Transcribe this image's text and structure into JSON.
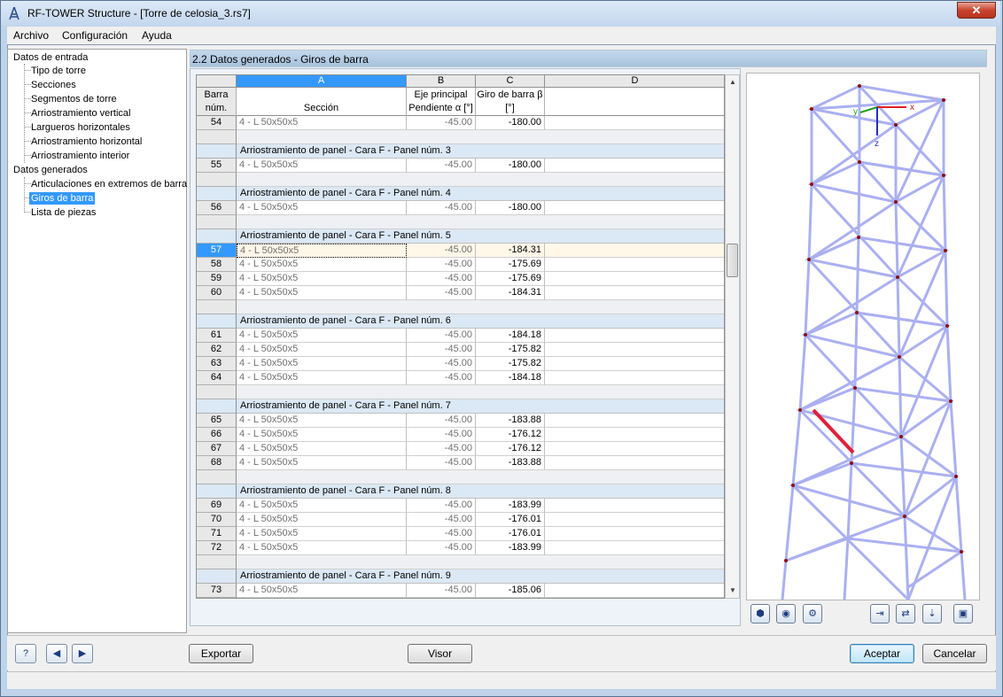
{
  "window": {
    "title": "RF-TOWER Structure - [Torre de celosia_3.rs7]",
    "close_label": "✕"
  },
  "menu": [
    "Archivo",
    "Configuración",
    "Ayuda"
  ],
  "tree": {
    "group1": "Datos de entrada",
    "group1_items": [
      "Tipo de torre",
      "Secciones",
      "Segmentos de torre",
      "Arriostramiento vertical",
      "Largueros horizontales",
      "Arriostramiento horizontal",
      "Arriostramiento interior"
    ],
    "group2": "Datos generados",
    "group2_items": [
      "Articulaciones en extremos de barra",
      "Giros de barra",
      "Lista de piezas"
    ],
    "selected": "Giros de barra"
  },
  "panel_title": "2.2 Datos generados - Giros de barra",
  "grid": {
    "columns": [
      "A",
      "B",
      "C",
      "D"
    ],
    "rowhdr_label": "Barra núm.",
    "headers": {
      "A": "Sección",
      "B": "Eje principal Pendiente α [°]",
      "C": "Giro de barra β [°]",
      "D": ""
    },
    "rows": [
      {
        "kind": "data",
        "num": "54",
        "section": "4 - L 50x50x5",
        "alpha": "-45.00",
        "beta": "-180.00"
      },
      {
        "kind": "blank"
      },
      {
        "kind": "group",
        "label": "Arriostramiento de panel  - Cara F  - Panel núm. 3"
      },
      {
        "kind": "data",
        "num": "55",
        "section": "4 - L 50x50x5",
        "alpha": "-45.00",
        "beta": "-180.00"
      },
      {
        "kind": "blank"
      },
      {
        "kind": "group",
        "label": "Arriostramiento de panel  - Cara F  - Panel núm. 4"
      },
      {
        "kind": "data",
        "num": "56",
        "section": "4 - L 50x50x5",
        "alpha": "-45.00",
        "beta": "-180.00"
      },
      {
        "kind": "blank"
      },
      {
        "kind": "group",
        "label": "Arriostramiento de panel  - Cara F  - Panel núm. 5"
      },
      {
        "kind": "data",
        "num": "57",
        "section": "4 - L 50x50x5",
        "alpha": "-45.00",
        "beta": "-184.31",
        "selected": true
      },
      {
        "kind": "data",
        "num": "58",
        "section": "4 - L 50x50x5",
        "alpha": "-45.00",
        "beta": "-175.69"
      },
      {
        "kind": "data",
        "num": "59",
        "section": "4 - L 50x50x5",
        "alpha": "-45.00",
        "beta": "-175.69"
      },
      {
        "kind": "data",
        "num": "60",
        "section": "4 - L 50x50x5",
        "alpha": "-45.00",
        "beta": "-184.31"
      },
      {
        "kind": "blank"
      },
      {
        "kind": "group",
        "label": "Arriostramiento de panel  - Cara F  - Panel núm. 6"
      },
      {
        "kind": "data",
        "num": "61",
        "section": "4 - L 50x50x5",
        "alpha": "-45.00",
        "beta": "-184.18"
      },
      {
        "kind": "data",
        "num": "62",
        "section": "4 - L 50x50x5",
        "alpha": "-45.00",
        "beta": "-175.82"
      },
      {
        "kind": "data",
        "num": "63",
        "section": "4 - L 50x50x5",
        "alpha": "-45.00",
        "beta": "-175.82"
      },
      {
        "kind": "data",
        "num": "64",
        "section": "4 - L 50x50x5",
        "alpha": "-45.00",
        "beta": "-184.18"
      },
      {
        "kind": "blank"
      },
      {
        "kind": "group",
        "label": "Arriostramiento de panel  - Cara F  - Panel núm. 7"
      },
      {
        "kind": "data",
        "num": "65",
        "section": "4 - L 50x50x5",
        "alpha": "-45.00",
        "beta": "-183.88"
      },
      {
        "kind": "data",
        "num": "66",
        "section": "4 - L 50x50x5",
        "alpha": "-45.00",
        "beta": "-176.12"
      },
      {
        "kind": "data",
        "num": "67",
        "section": "4 - L 50x50x5",
        "alpha": "-45.00",
        "beta": "-176.12"
      },
      {
        "kind": "data",
        "num": "68",
        "section": "4 - L 50x50x5",
        "alpha": "-45.00",
        "beta": "-183.88"
      },
      {
        "kind": "blank"
      },
      {
        "kind": "group",
        "label": "Arriostramiento de panel  - Cara F  - Panel núm. 8"
      },
      {
        "kind": "data",
        "num": "69",
        "section": "4 - L 50x50x5",
        "alpha": "-45.00",
        "beta": "-183.99"
      },
      {
        "kind": "data",
        "num": "70",
        "section": "4 - L 50x50x5",
        "alpha": "-45.00",
        "beta": "-176.01"
      },
      {
        "kind": "data",
        "num": "71",
        "section": "4 - L 50x50x5",
        "alpha": "-45.00",
        "beta": "-176.01"
      },
      {
        "kind": "data",
        "num": "72",
        "section": "4 - L 50x50x5",
        "alpha": "-45.00",
        "beta": "-183.99"
      },
      {
        "kind": "blank"
      },
      {
        "kind": "group",
        "label": "Arriostramiento de panel  - Cara F  - Panel núm. 9"
      },
      {
        "kind": "data",
        "num": "73",
        "section": "4 - L 50x50x5",
        "alpha": "-45.00",
        "beta": "-185.06"
      }
    ]
  },
  "viewer": {
    "axis_labels": {
      "x": "x",
      "y": "y",
      "z": "z"
    },
    "tool_icons": [
      "view-iso-icon",
      "render-icon",
      "display-options-icon",
      "view-x-icon",
      "view-y-icon",
      "view-z-icon",
      "view-3d-icon"
    ]
  },
  "buttons": {
    "export": "Exportar",
    "viewer": "Visor",
    "accept": "Aceptar",
    "cancel": "Cancelar"
  },
  "colors": {
    "tower_member": "#aab0f0",
    "highlight_member": "#e0203a",
    "selection": "#3399ff",
    "group_row": "#dbe8f5"
  }
}
